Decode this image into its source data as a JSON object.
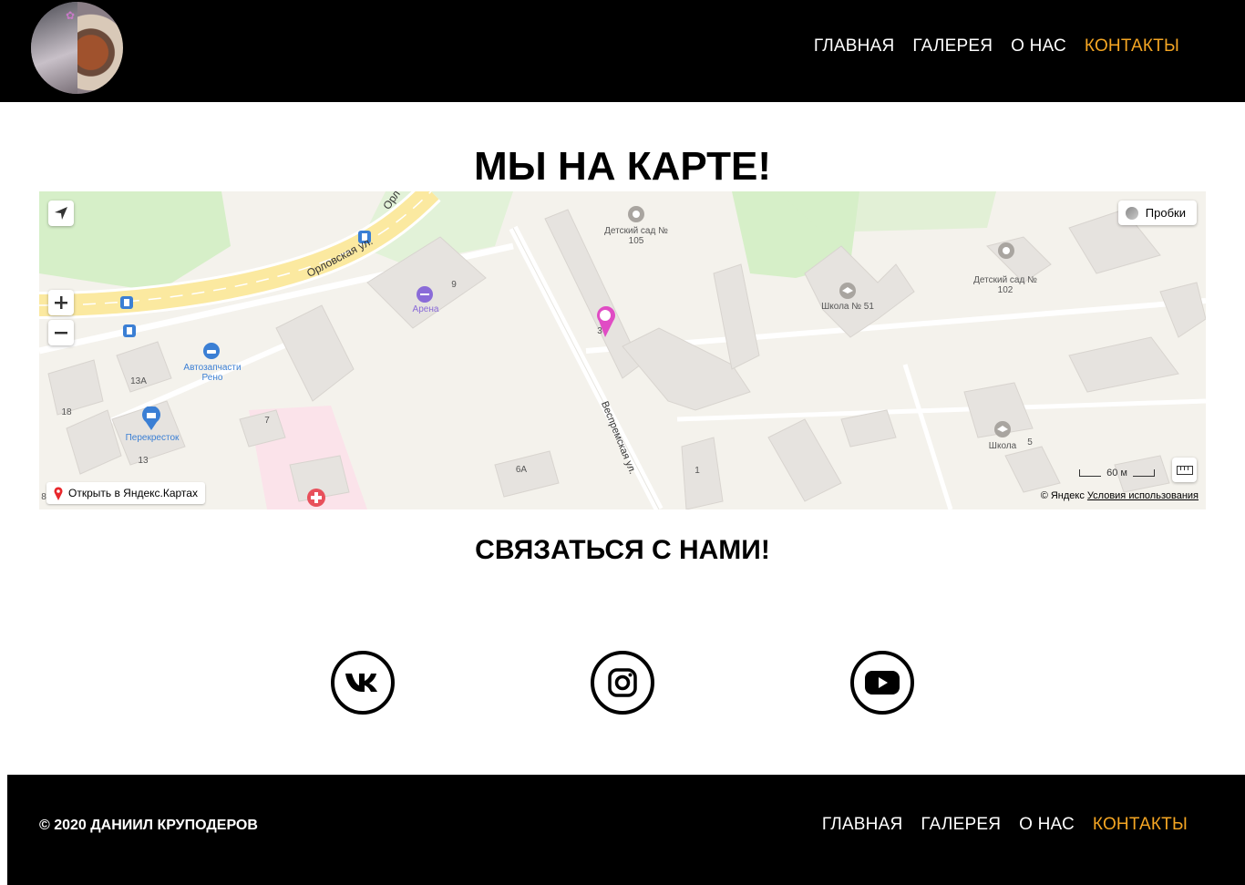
{
  "header": {
    "nav": [
      {
        "label": "ГЛАВНАЯ",
        "active": false
      },
      {
        "label": "ГАЛЕРЕЯ",
        "active": false
      },
      {
        "label": "О НАС",
        "active": false
      },
      {
        "label": "КОНТАКТЫ",
        "active": true
      }
    ]
  },
  "map_section": {
    "title": "МЫ НА КАРТЕ!",
    "traffic_label": "Пробки",
    "open_link": "Открыть в Яндекс.Картах",
    "scale": "60 м",
    "copyright": "© Яндекс",
    "terms": "Условия использования",
    "labels": {
      "kindergarten_105": "Детский сад № 105",
      "kindergarten_102": "Детский сад № 102",
      "school_51": "Школа № 51",
      "school": "Школа",
      "arena": "Арена",
      "autoparts": "Автозапчасти Рено",
      "perekrestok": "Перекресток",
      "street_orlovskaya": "Орловская ул.",
      "street_orl": "Орл",
      "street_vespremskaya": "Веспремская ул.",
      "num_9": "9",
      "num_3": "3",
      "num_13a": "13А",
      "num_18": "18",
      "num_13": "13",
      "num_7": "7",
      "num_6a": "6А",
      "num_1": "1",
      "num_5": "5",
      "num_8": "8"
    }
  },
  "contact_section": {
    "title": "СВЯЗАТЬСЯ С НАМИ!",
    "social": [
      {
        "name": "vk",
        "icon": "vk-icon"
      },
      {
        "name": "instagram",
        "icon": "instagram-icon"
      },
      {
        "name": "youtube",
        "icon": "youtube-icon"
      }
    ]
  },
  "footer": {
    "copyright": "© 2020 ДАНИИЛ КРУПОДЕРОВ",
    "nav": [
      {
        "label": "ГЛАВНАЯ",
        "active": false
      },
      {
        "label": "ГАЛЕРЕЯ",
        "active": false
      },
      {
        "label": "О НАС",
        "active": false
      },
      {
        "label": "КОНТАКТЫ",
        "active": true
      }
    ]
  },
  "colors": {
    "header_bg": "#000000",
    "accent": "#f5a623",
    "marker": "#e04cc4"
  }
}
